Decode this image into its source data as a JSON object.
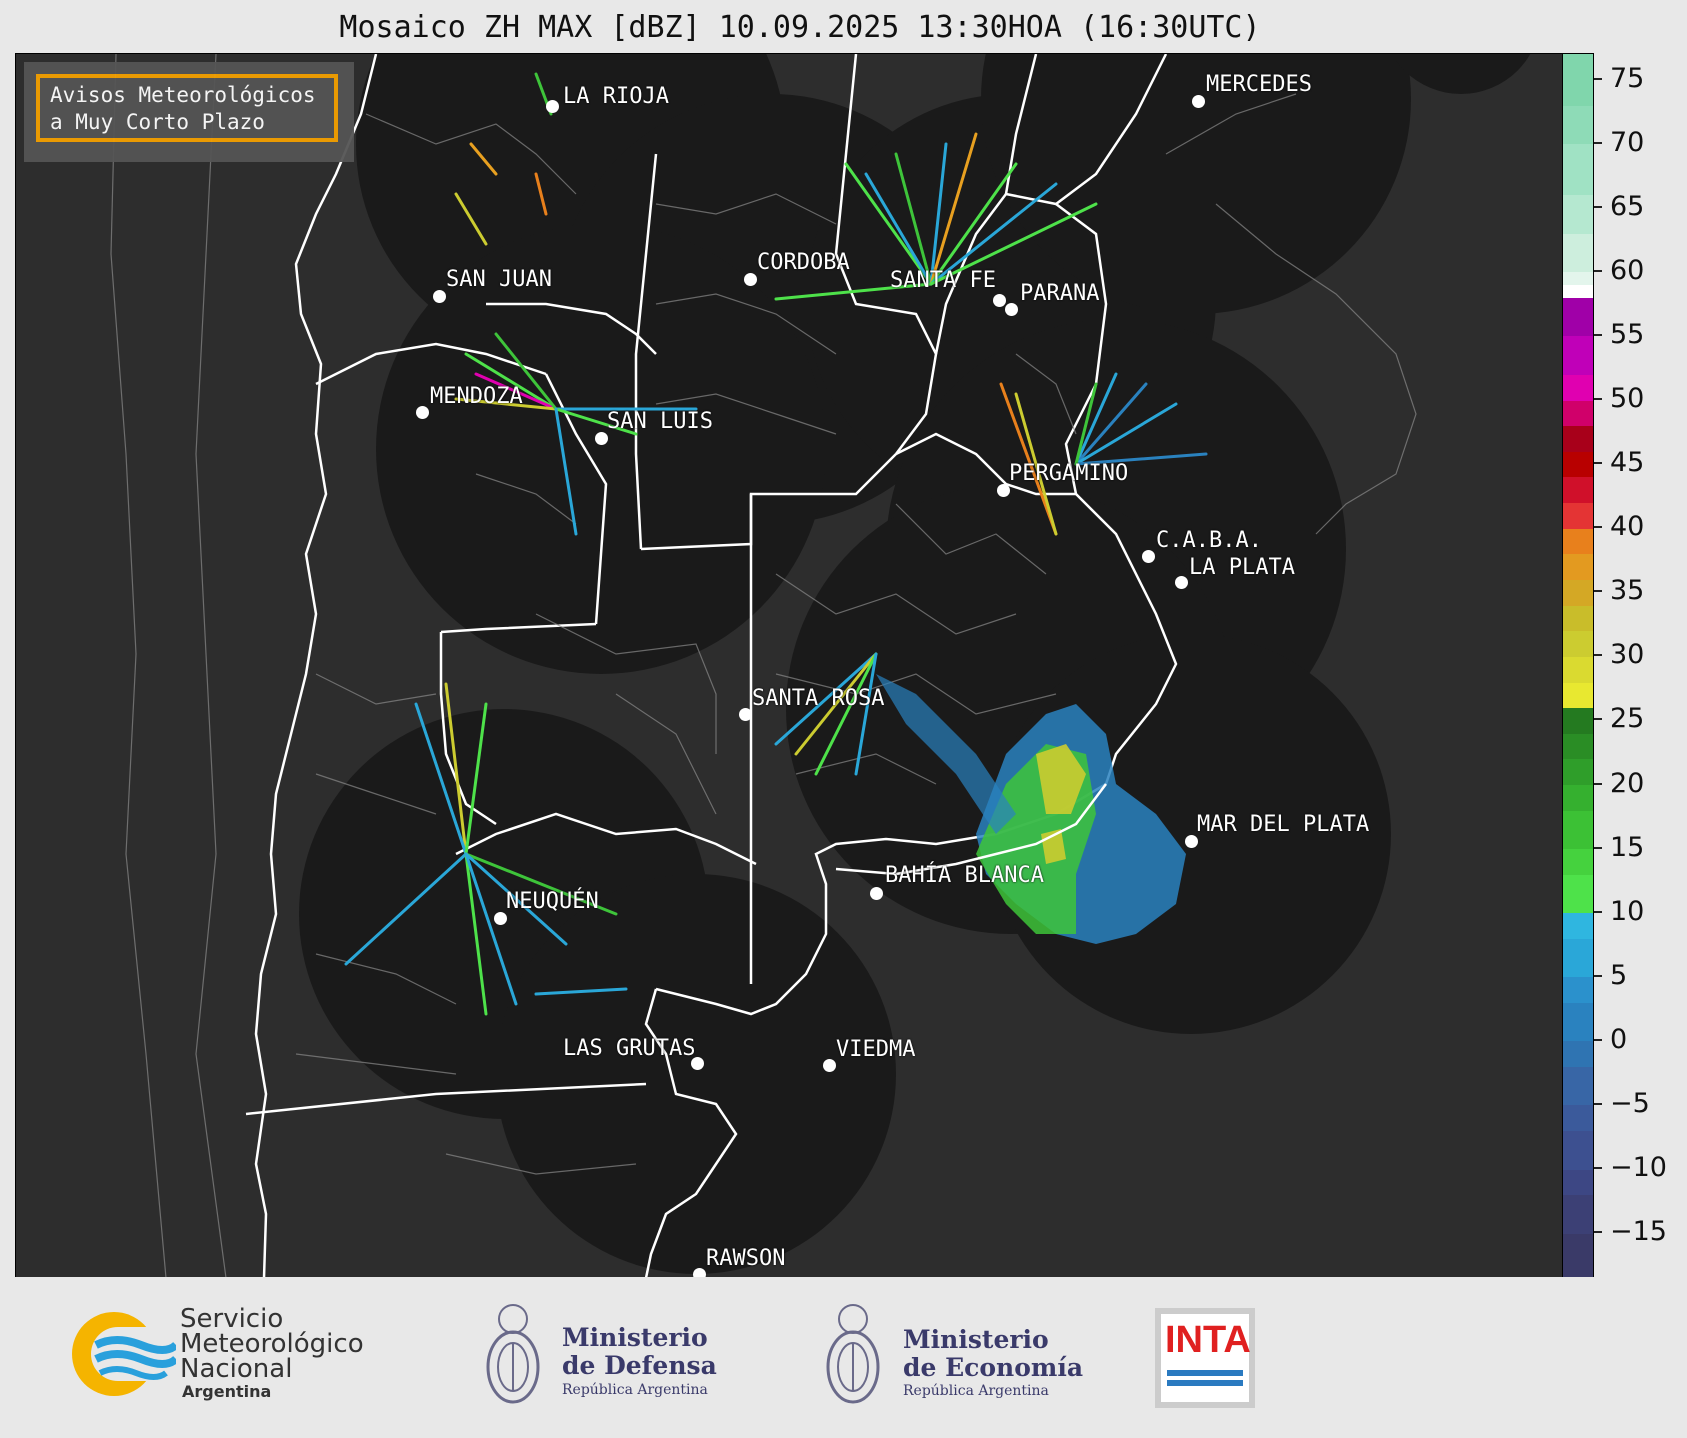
{
  "title": "Mosaico ZH MAX [dBZ] 10.09.2025 13:30HOA (16:30UTC)",
  "notice": {
    "line1": "Avisos Meteorológicos",
    "line2": "a Muy Corto Plazo"
  },
  "cities": [
    {
      "name": "LA RIOJA"
    },
    {
      "name": "CORDOBA"
    },
    {
      "name": "SAN JUAN"
    },
    {
      "name": "SANTA FE"
    },
    {
      "name": "PARANA"
    },
    {
      "name": "MERCEDES"
    },
    {
      "name": "MENDOZA"
    },
    {
      "name": "SAN LUIS"
    },
    {
      "name": "PERGAMINO"
    },
    {
      "name": "C.A.B.A."
    },
    {
      "name": "LA PLATA"
    },
    {
      "name": "SANTA ROSA"
    },
    {
      "name": "MAR DEL PLATA"
    },
    {
      "name": "BAHÍA BLANCA"
    },
    {
      "name": "NEUQUÉN"
    },
    {
      "name": "LAS GRUTAS"
    },
    {
      "name": "VIEDMA"
    },
    {
      "name": "RAWSON"
    }
  ],
  "colorbar": {
    "unit": "dBZ",
    "min": -18.5,
    "max": 77,
    "ticks": [
      "75",
      "70",
      "65",
      "60",
      "55",
      "50",
      "45",
      "40",
      "35",
      "30",
      "25",
      "20",
      "15",
      "10",
      "5",
      "0",
      "−5",
      "−10",
      "−15"
    ],
    "tick_values": [
      75,
      70,
      65,
      60,
      55,
      50,
      45,
      40,
      35,
      30,
      25,
      20,
      15,
      10,
      5,
      0,
      -5,
      -10,
      -15
    ],
    "colors": [
      "#3a3a68",
      "#3c4075",
      "#3d4784",
      "#3d5090",
      "#3b5a9b",
      "#3866a6",
      "#2f74b2",
      "#2a82bf",
      "#2b91cc",
      "#2aa7d8",
      "#2fb6e0",
      "#4ee24a",
      "#45d23e",
      "#3cc135",
      "#35b02f",
      "#2f9e2a",
      "#2a8d25",
      "#247a20",
      "#e8e830",
      "#dada30",
      "#cccc30",
      "#c9bd2a",
      "#d4a825",
      "#e39a20",
      "#e8801c",
      "#e43434",
      "#d0102a",
      "#b80000",
      "#a8001a",
      "#d0006a",
      "#e000b0",
      "#c000b8",
      "#a000a8",
      "#ffffff",
      "#e3f5ec",
      "#cdeedd",
      "#b5e8d0",
      "#a0e2c4",
      "#8edbb7",
      "#80d6ac"
    ],
    "color_breaks": [
      -18.5,
      -15,
      -12,
      -10,
      -7,
      -5,
      -2,
      0,
      3,
      5,
      8,
      10,
      13,
      15,
      18,
      20,
      22,
      24,
      26,
      28,
      30,
      32,
      34,
      36,
      38,
      40,
      42,
      44,
      46,
      48,
      50,
      52,
      55,
      58,
      59,
      60,
      63,
      66,
      70,
      73,
      77
    ]
  },
  "logos": {
    "smn": {
      "line1": "Servicio",
      "line2": "Meteorológico",
      "line3": "Nacional",
      "sub": "Argentina"
    },
    "defensa": {
      "line1": "Ministerio",
      "line2": "de Defensa",
      "sub": "República Argentina"
    },
    "economia": {
      "line1": "Ministerio",
      "line2": "de Economía",
      "sub": "República Argentina"
    },
    "inta": {
      "text": "INTA"
    }
  }
}
